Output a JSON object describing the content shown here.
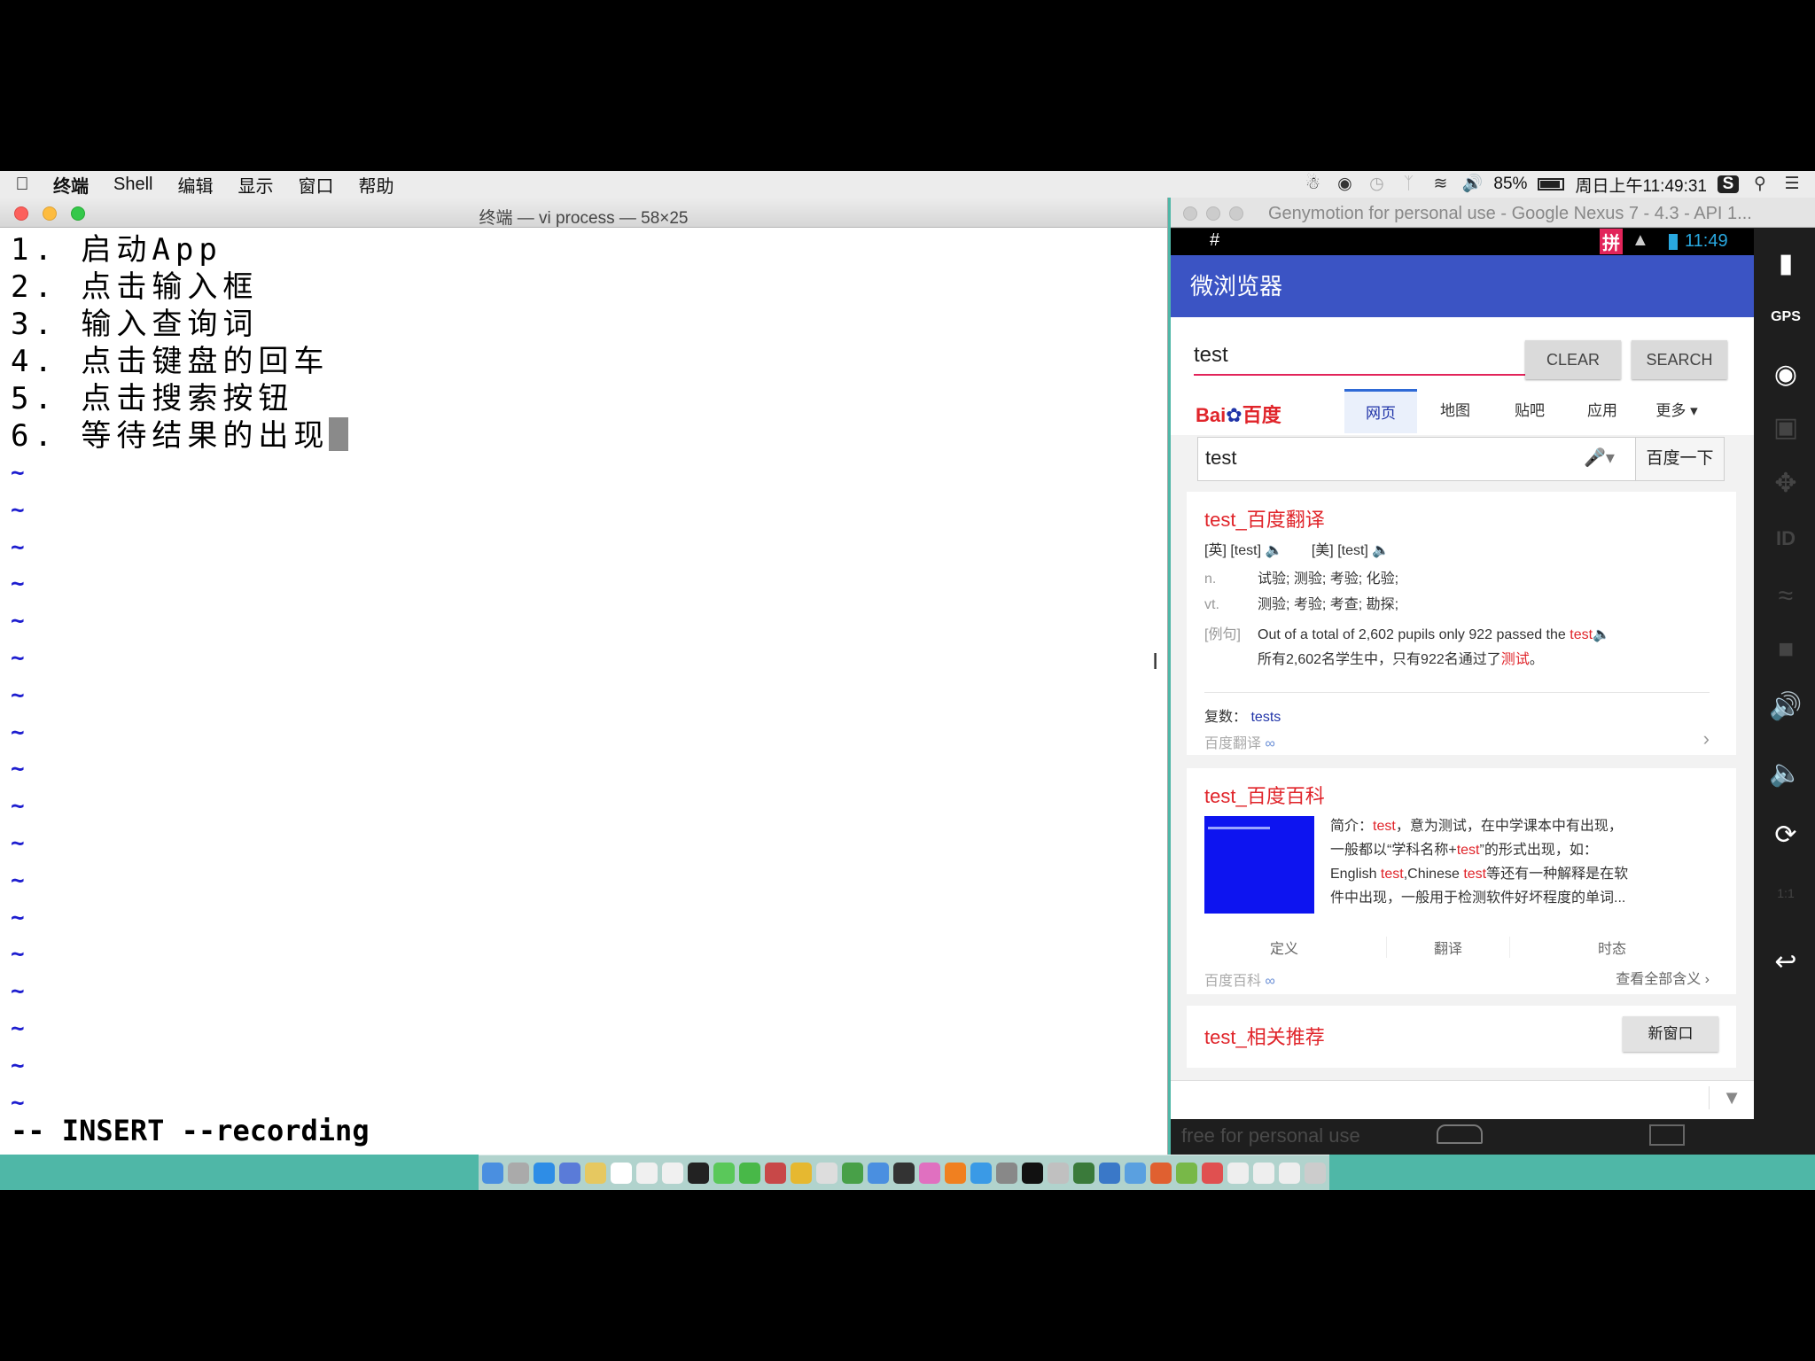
{
  "menubar": {
    "app_name": "终端",
    "items": [
      "Shell",
      "编辑",
      "显示",
      "窗口",
      "帮助"
    ],
    "battery": "85%",
    "clock": "周日上午11:49:31"
  },
  "terminal": {
    "title": "终端 — vi process — 58×25",
    "lines": [
      "1. 启动App",
      "2. 点击输入框",
      "3. 输入查询词",
      "4. 点击键盘的回车",
      "5. 点击搜索按钮",
      "6. 等待结果的出现"
    ],
    "tilde": "~",
    "status": "-- INSERT --recording"
  },
  "genymotion": {
    "title": "Genymotion for personal use - Google Nexus 7 - 4.3 - API 1...",
    "watermark": "free for personal use",
    "android": {
      "status_left": "#",
      "status_ime": "拼",
      "status_time": "11:49",
      "app_title": "微浏览器",
      "query_value": "test",
      "clear_label": "CLEAR",
      "search_label": "SEARCH",
      "baidu": {
        "logo": "Bai百度",
        "tabs": [
          "网页",
          "地图",
          "贴吧",
          "应用",
          "更多 ▾"
        ],
        "search_value": "test",
        "search_button": "百度一下",
        "translate": {
          "title": "test_百度翻译",
          "phon_uk": "[英] [test]",
          "phon_us": "[美] [test]",
          "n_tag": "n.",
          "n_text": "试验; 测验; 考验; 化验;",
          "vt_tag": "vt.",
          "vt_text": "测验; 考验; 考查; 勘探;",
          "ex_tag": "[例句]",
          "ex_en_prefix": "Out of a total of 2,602 pupils only 922 passed the",
          "ex_en_word": "test",
          "ex_zh_prefix": "所有2,602名学生中，只有922名通过了",
          "ex_zh_word": "测试",
          "ex_zh_suffix": "。",
          "plural_label": "复数：",
          "plural_value": "tests",
          "source": "百度翻译"
        },
        "baike": {
          "title": "test_百度百科",
          "intro_1a": "简介：",
          "intro_1b": "test",
          "intro_1c": "，意为测试，在中学课本中有出现，",
          "intro_2a": "一般都以“学科名称+",
          "intro_2b": "test",
          "intro_2c": "”的形式出现，如：",
          "intro_3a": "English ",
          "intro_3b": "test",
          "intro_3c": ",Chinese ",
          "intro_3d": "test",
          "intro_3e": "等还有一种解释是在软",
          "intro_4": "件中出现，一般用于检测软件好坏程度的单词...",
          "tabs": [
            "定义",
            "翻译",
            "时态"
          ],
          "source": "百度百科",
          "more": "查看全部含义"
        },
        "related": {
          "title": "test_相关推荐",
          "button": "新窗口"
        }
      }
    }
  },
  "colors": {
    "desktop": "#4fb7a7",
    "appbar": "#3b54c4",
    "accent_red": "#e0242a",
    "input_underline": "#e2245a",
    "vi_tilde": "#1d1dcf"
  }
}
